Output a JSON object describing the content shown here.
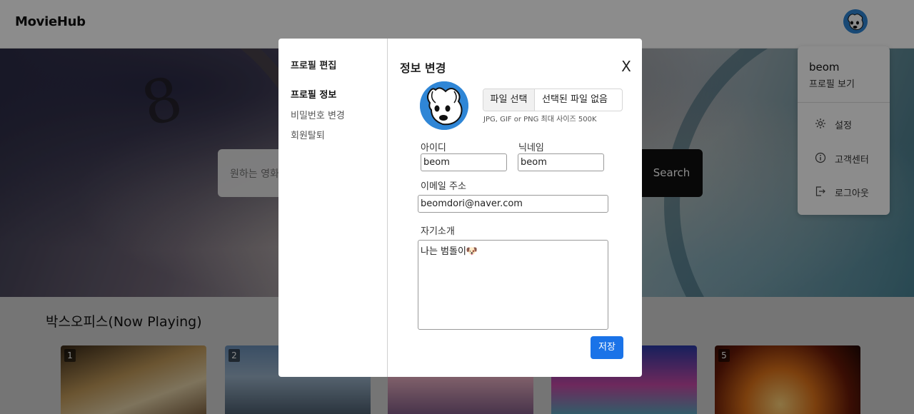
{
  "app": {
    "brand": "MovieHub"
  },
  "hero": {
    "search_placeholder": "원하는 영화",
    "search_button": "Search"
  },
  "boxoffice": {
    "title": "박스오피스(Now Playing)",
    "posters": [
      {
        "rank": "1"
      },
      {
        "rank": "2"
      },
      {
        "rank": "3"
      },
      {
        "rank": "4"
      },
      {
        "rank": "5"
      }
    ]
  },
  "user_menu": {
    "username": "beom",
    "view_profile": "프로필 보기",
    "items": [
      {
        "label": "설정",
        "icon": "gear-icon"
      },
      {
        "label": "고객센터",
        "icon": "info-icon"
      },
      {
        "label": "로그아웃",
        "icon": "logout-icon"
      }
    ]
  },
  "modal": {
    "sidebar": {
      "title": "프로필 편집",
      "items": [
        {
          "label": "프로필 정보",
          "active": true
        },
        {
          "label": "비밀번호 변경"
        },
        {
          "label": "회원탈퇴"
        }
      ]
    },
    "title": "정보 변경",
    "close": "X",
    "file": {
      "button": "파일 선택",
      "status": "선택된 파일 없음",
      "hint": "JPG, GIF or PNG 최대 사이즈 500K"
    },
    "fields": {
      "id_label": "아이디",
      "id_value": "beom",
      "nickname_label": "닉네임",
      "nickname_value": "beom",
      "email_label": "이메일 주소",
      "email_value": "beomdori@naver.com",
      "bio_label": "자기소개",
      "bio_value": "나는 범돌이🐶"
    },
    "save": "저장"
  },
  "colors": {
    "primary": "#1a73e8",
    "avatar_bg": "#2f86d6",
    "overlay": "rgba(0,0,0,0.45)"
  }
}
